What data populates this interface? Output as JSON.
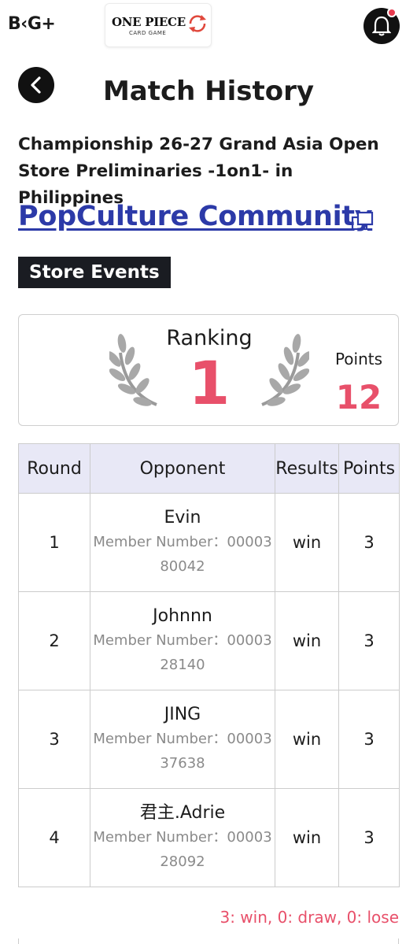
{
  "header": {
    "brand_logo": "B‹G+",
    "game_logo_title": "ONE PIECE",
    "game_logo_subtitle": "CARD GAME",
    "notification_icon": "bell-icon"
  },
  "page": {
    "title": "Match History",
    "back_icon": "chevron-left-icon"
  },
  "event": {
    "name": "Championship 26-27 Grand Asia Open Store Preliminaries -1on1- in Philippines",
    "store_name": "PopCulture Community",
    "store_link_icon": "external-link-icon",
    "category_tag": "Store Events"
  },
  "ranking": {
    "label": "Ranking",
    "value": "1",
    "points_label": "Points",
    "points_value": "12"
  },
  "table": {
    "headers": [
      "Round",
      "Opponent",
      "Results",
      "Points"
    ],
    "rows": [
      {
        "round": "1",
        "opponent": "Evin",
        "member": "Member Number：0000380042",
        "result": "win",
        "points": "3"
      },
      {
        "round": "2",
        "opponent": "Johnnn",
        "member": "Member Number：0000328140",
        "result": "win",
        "points": "3"
      },
      {
        "round": "3",
        "opponent": "JING",
        "member": "Member Number：0000337638",
        "result": "win",
        "points": "3"
      },
      {
        "round": "4",
        "opponent": "君主.Adrie",
        "member": "Member Number：0000328092",
        "result": "win",
        "points": "3"
      }
    ]
  },
  "summary": "3: win, 0: draw, 0: lose",
  "colors": {
    "accent": "#e8506a",
    "link": "#2c3aa8",
    "header_bg": "#e8e8f6",
    "tag_bg": "#1a1c22"
  }
}
